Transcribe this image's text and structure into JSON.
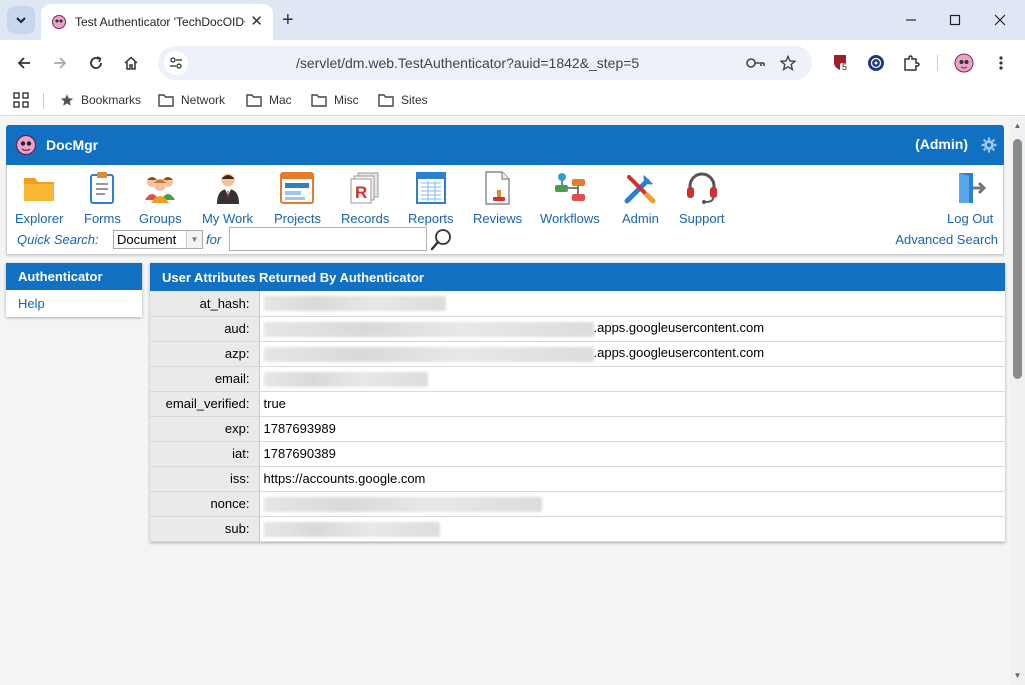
{
  "browser": {
    "tab_title": "Test Authenticator 'TechDocOIDC'",
    "url": "/servlet/dm.web.TestAuthenticator?auid=1842&_step=5",
    "extension_badge": "5",
    "bookmarks": [
      {
        "label": "Bookmarks",
        "icon": "star-icon"
      },
      {
        "label": "Network",
        "icon": "folder-icon"
      },
      {
        "label": "Mac",
        "icon": "folder-icon"
      },
      {
        "label": "Misc",
        "icon": "folder-icon"
      },
      {
        "label": "Sites",
        "icon": "folder-icon"
      }
    ]
  },
  "app": {
    "title": "DocMgr",
    "user": "(Admin)",
    "toolbar": [
      {
        "label": "Explorer",
        "icon": "folder-icon",
        "color": "#f0a020"
      },
      {
        "label": "Forms",
        "icon": "clipboard-icon",
        "color": "#2d7fd1"
      },
      {
        "label": "Groups",
        "icon": "group-icon",
        "color": "#e05050"
      },
      {
        "label": "My Work",
        "icon": "person-icon",
        "color": "#333333"
      },
      {
        "label": "Projects",
        "icon": "window-icon",
        "color": "#e87a30"
      },
      {
        "label": "Records",
        "icon": "records-icon",
        "color": "#d03030"
      },
      {
        "label": "Reports",
        "icon": "report-icon",
        "color": "#2d7fd1"
      },
      {
        "label": "Reviews",
        "icon": "document-stamp-icon",
        "color": "#e08a30"
      },
      {
        "label": "Workflows",
        "icon": "workflow-icon",
        "color": "#2d9fd1"
      },
      {
        "label": "Admin",
        "icon": "tools-icon",
        "color": "#2d7fd1"
      },
      {
        "label": "Support",
        "icon": "headset-icon",
        "color": "#d03030"
      }
    ],
    "logout": "Log Out",
    "quick_search": {
      "label": "Quick Search:",
      "selected": "Document",
      "for_label": "for",
      "value": ""
    },
    "advanced_search": "Advanced Search"
  },
  "sidebar": {
    "title": "Authenticator",
    "items": [
      "Help"
    ]
  },
  "main": {
    "title": "User Attributes Returned By Authenticator",
    "rows": [
      {
        "key": "at_hash:",
        "value": "",
        "redacted": true
      },
      {
        "key": "aud:",
        "value": ".apps.googleusercontent.com",
        "redacted": true
      },
      {
        "key": "azp:",
        "value": ".apps.googleusercontent.com",
        "redacted": true
      },
      {
        "key": "email:",
        "value": "",
        "redacted": true
      },
      {
        "key": "email_verified:",
        "value": "true",
        "redacted": false
      },
      {
        "key": "exp:",
        "value": "1787693989",
        "redacted": false
      },
      {
        "key": "iat:",
        "value": "1787690389",
        "redacted": false
      },
      {
        "key": "iss:",
        "value": "https://accounts.google.com",
        "redacted": false
      },
      {
        "key": "nonce:",
        "value": "",
        "redacted": true
      },
      {
        "key": "sub:",
        "value": "",
        "redacted": true
      }
    ]
  },
  "colors": {
    "accent": "#1170c1",
    "link": "#1763b5",
    "chrome_bg": "#dfe7f4"
  }
}
